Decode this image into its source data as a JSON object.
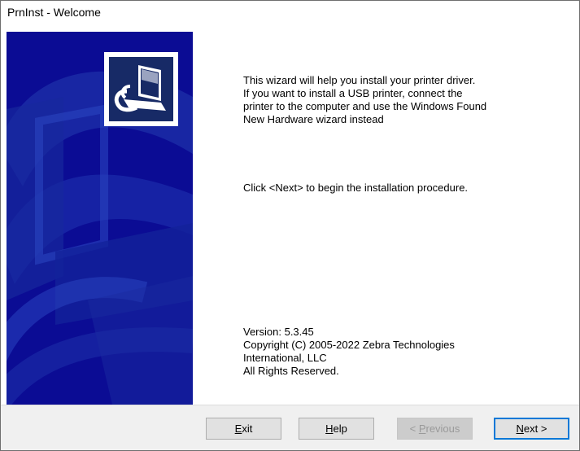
{
  "window": {
    "title": "PrnInst - Welcome"
  },
  "banner": {
    "logo_icon": "printer-install-icon",
    "background_color": "#0b0c94"
  },
  "content": {
    "intro_lines": [
      "This wizard will help you install your printer driver.",
      "If you want to install a USB printer, connect the",
      "printer to the computer and use the Windows Found",
      "New Hardware wizard instead"
    ],
    "instruction": "Click <Next> to begin the installation procedure.",
    "version": "Version: 5.3.45",
    "copyright_lines": [
      "Copyright (C) 2005-2022 Zebra Technologies",
      "International, LLC",
      "All Rights Reserved."
    ]
  },
  "buttons": {
    "exit": {
      "mnemonic": "E",
      "rest": "xit"
    },
    "help": {
      "mnemonic": "H",
      "rest": "elp"
    },
    "previous": {
      "prefix": "< ",
      "mnemonic": "P",
      "rest": "revious",
      "enabled": false
    },
    "next": {
      "mnemonic": "N",
      "rest": "ext >"
    }
  }
}
